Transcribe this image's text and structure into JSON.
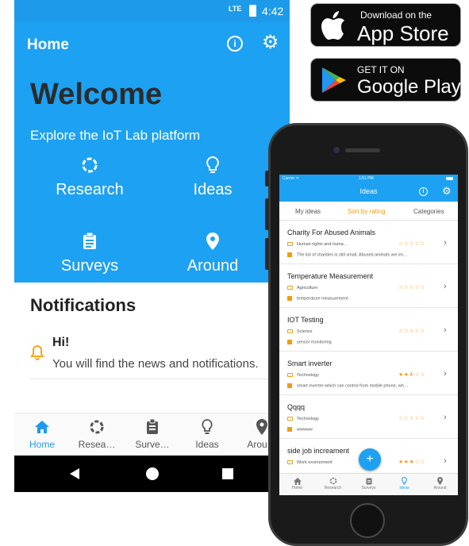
{
  "android": {
    "status": {
      "network": "LTE",
      "time": "4:42"
    },
    "header": {
      "title": "Home"
    },
    "hero": {
      "welcome": "Welcome",
      "subtitle": "Explore the IoT Lab platform"
    },
    "tiles": [
      {
        "label": "Research",
        "icon": "research-icon"
      },
      {
        "label": "Ideas",
        "icon": "lightbulb-icon"
      },
      {
        "label": "Surveys",
        "icon": "clipboard-icon"
      },
      {
        "label": "Around",
        "icon": "location-pin-icon"
      }
    ],
    "notifications": {
      "title": "Notifications",
      "items": [
        {
          "title": "Hi!",
          "body": "You will find the news and notifications."
        }
      ]
    },
    "tabs": [
      {
        "label": "Home",
        "active": true
      },
      {
        "label": "Resea…",
        "active": false
      },
      {
        "label": "Surve…",
        "active": false
      },
      {
        "label": "Ideas",
        "active": false
      },
      {
        "label": "Arou…",
        "active": false
      }
    ]
  },
  "badges": {
    "appstore": {
      "small": "Download on the",
      "big": "App Store"
    },
    "googleplay": {
      "small": "GET IT ON",
      "big": "Google Play"
    }
  },
  "ios": {
    "status": {
      "carrier": "Carrier ᯤ",
      "time": "1:51 PM"
    },
    "nav": {
      "title": "Ideas"
    },
    "segments": [
      "My ideas",
      "Sort by rating",
      "Categories"
    ],
    "active_segment": 1,
    "ideas": [
      {
        "title": "Charity For Abused Animals",
        "category": "Human rights and huma…",
        "description": "The list of charities is still small. Abused animals are im…",
        "rating": 0
      },
      {
        "title": "Temperature Measurement",
        "category": "Agriculture",
        "description": "temperature measurement",
        "rating": 0
      },
      {
        "title": "IOT Testing",
        "category": "Science",
        "description": "sensor monitoring",
        "rating": 0
      },
      {
        "title": "Smart inverter",
        "category": "Technology",
        "description": "smart inverter which can control from mobile phone, wh…",
        "rating": 2.5
      },
      {
        "title": "Qqqq",
        "category": "Technology",
        "description": "wwwww",
        "rating": 0
      },
      {
        "title": "side job increament",
        "category": "Work environment",
        "description": "",
        "rating": 3
      }
    ],
    "fab_label": "+",
    "tabs": [
      {
        "label": "Home",
        "active": false
      },
      {
        "label": "Research",
        "active": false
      },
      {
        "label": "Surveys",
        "active": false
      },
      {
        "label": "Ideas",
        "active": true
      },
      {
        "label": "Around",
        "active": false
      }
    ]
  },
  "colors": {
    "primary": "#1da1f2",
    "accent": "#f39c12",
    "bell": "#f5a623"
  }
}
